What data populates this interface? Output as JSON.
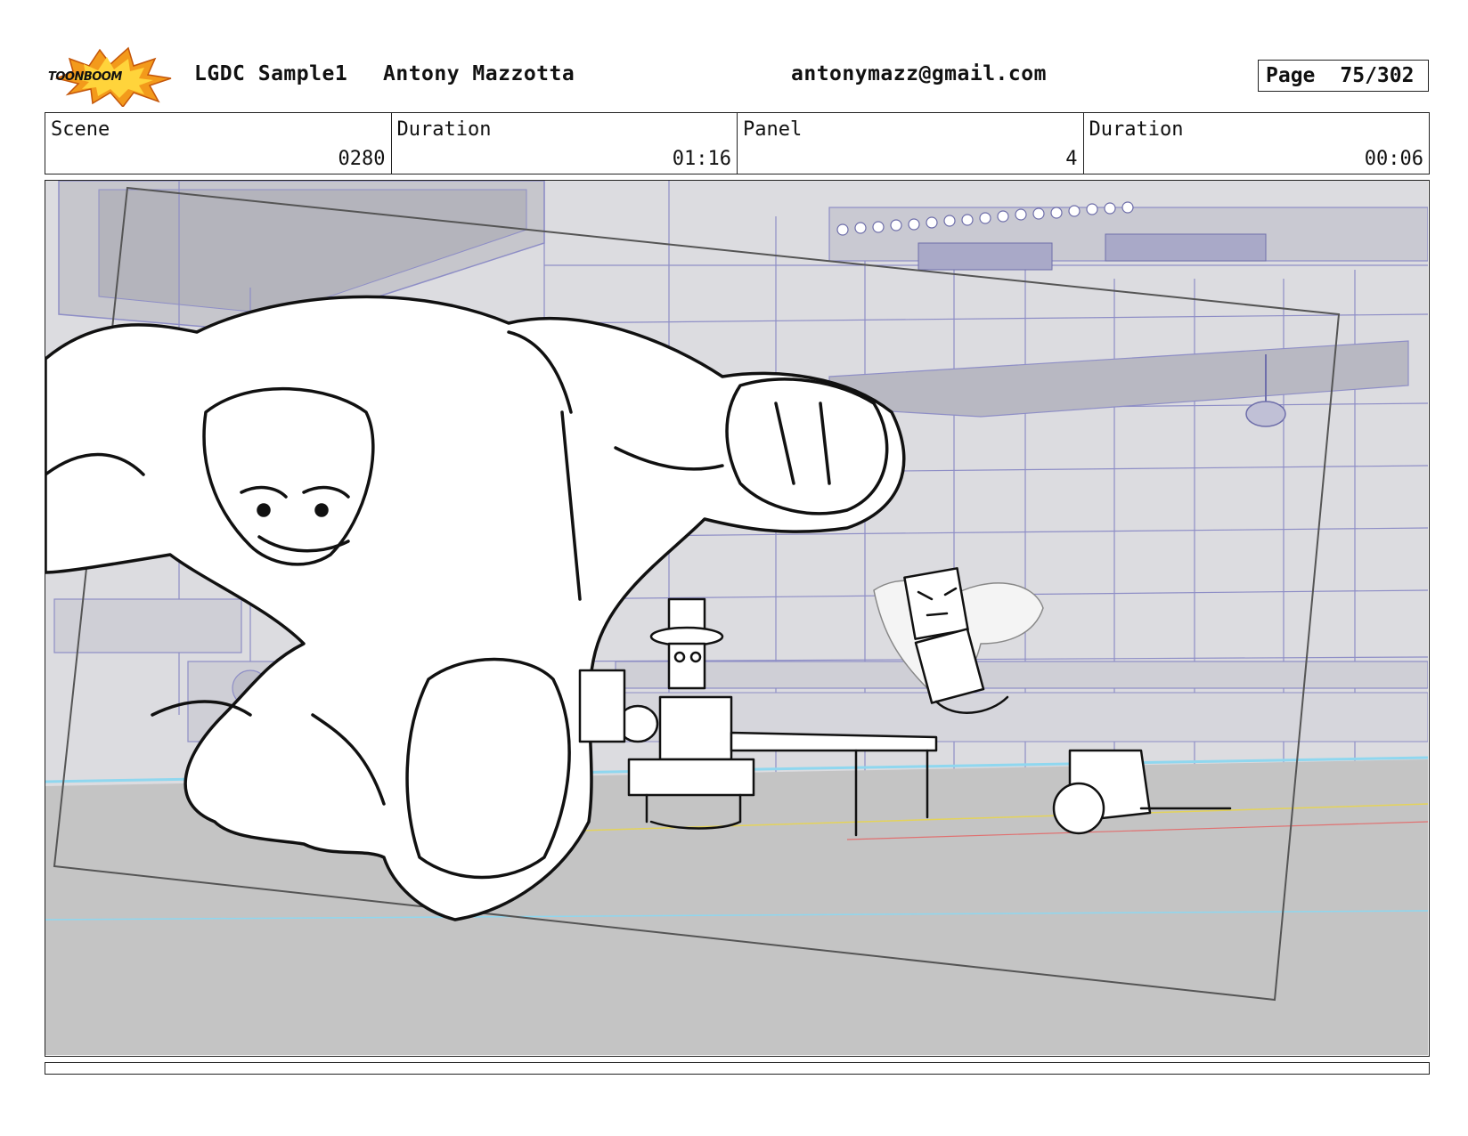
{
  "header": {
    "logo_text": "TOONBOOM",
    "project": "LGDC Sample1",
    "author": "Antony Mazzotta",
    "email": "antonymazz@gmail.com",
    "page_label": "Page",
    "page_value": "75/302"
  },
  "info": {
    "scene_label": "Scene",
    "scene_value": "0280",
    "scene_duration_label": "Duration",
    "scene_duration_value": "01:16",
    "panel_label": "Panel",
    "panel_value": "4",
    "panel_duration_label": "Duration",
    "panel_duration_value": "00:06"
  },
  "colors": {
    "logo_orange": "#f39a1b",
    "logo_yellow": "#ffd43b",
    "background_wall": "#d9d9dd",
    "blue_lines": "#8e8ec6",
    "floor": "#c4c4c4"
  }
}
